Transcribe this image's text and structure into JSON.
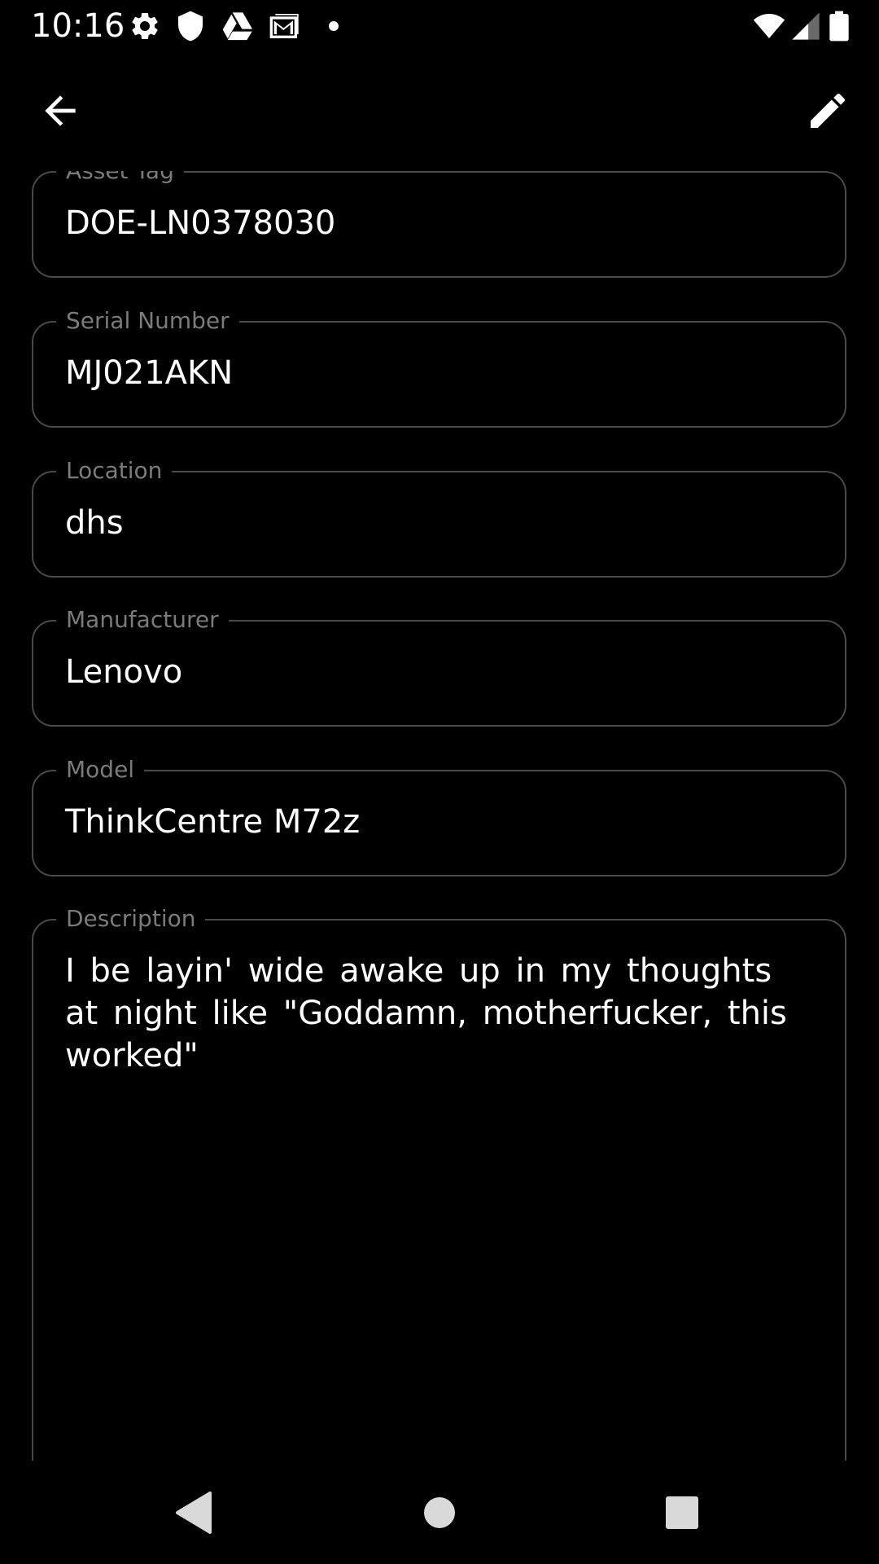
{
  "status_bar": {
    "time": "10:16",
    "left_icons": [
      "settings-icon",
      "shield-icon",
      "drive-icon",
      "gmail-icon",
      "dot-icon"
    ],
    "right_icons": [
      "wifi-icon",
      "signal-icon",
      "battery-icon"
    ]
  },
  "app_bar": {
    "back_icon": "arrow-back-icon",
    "edit_icon": "pencil-icon"
  },
  "fields": {
    "asset_tag": {
      "label": "Asset Tag",
      "value": "DOE-LN0378030"
    },
    "serial_number": {
      "label": "Serial Number",
      "value": "MJ021AKN"
    },
    "location": {
      "label": "Location",
      "value": "dhs"
    },
    "manufacturer": {
      "label": "Manufacturer",
      "value": "Lenovo"
    },
    "model": {
      "label": "Model",
      "value": "ThinkCentre M72z"
    },
    "description": {
      "label": "Description",
      "value": "I be layin' wide awake up in my thoughts at night like \"Goddamn, motherfucker, this worked\""
    }
  },
  "nav_bar": {
    "icons": [
      "nav-back-icon",
      "nav-home-icon",
      "nav-recents-icon"
    ]
  },
  "colors": {
    "background": "#000000",
    "text": "#ffffff",
    "label": "#7b7b7b",
    "outline": "#4a4a4a",
    "nav_icon": "#d9d9d9"
  }
}
